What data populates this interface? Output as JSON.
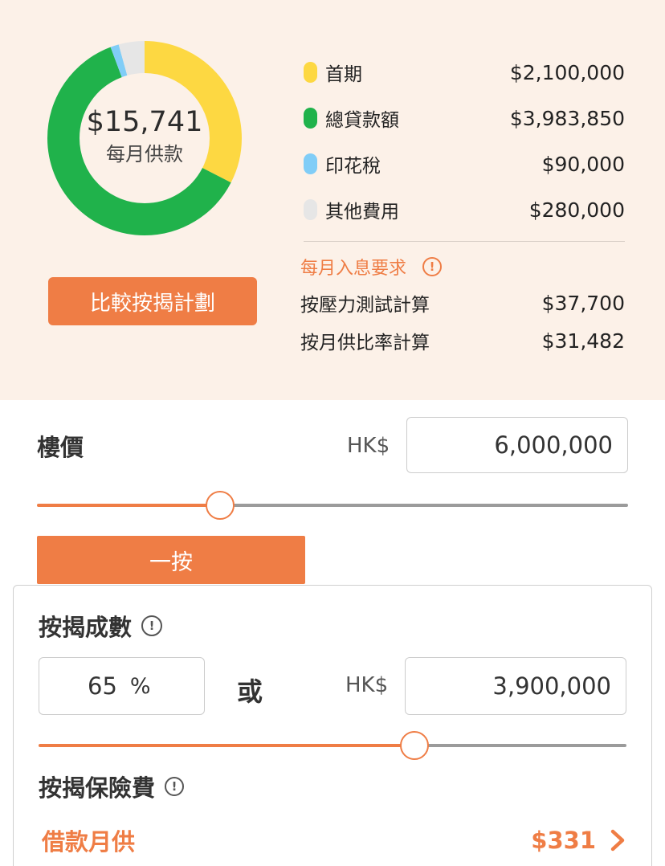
{
  "summary": {
    "monthly_amount": "$15,741",
    "monthly_label": "每月供款",
    "compare_button": "比較按揭計劃",
    "legend": [
      {
        "label": "首期",
        "value": "$2,100,000",
        "amount": 2100000,
        "color": "#fdd842"
      },
      {
        "label": "總貸款額",
        "value": "$3,983,850",
        "amount": 3983850,
        "color": "#20b24b"
      },
      {
        "label": "印花稅",
        "value": "$90,000",
        "amount": 90000,
        "color": "#80cdf7"
      },
      {
        "label": "其他費用",
        "value": "$280,000",
        "amount": 280000,
        "color": "#e6e6e6"
      }
    ],
    "interest_title": "每月入息要求",
    "interest_rows": [
      {
        "label": "按壓力測試計算",
        "value": "$37,700"
      },
      {
        "label": "按月供比率計算",
        "value": "$31,482"
      }
    ]
  },
  "property": {
    "label": "樓價",
    "currency": "HK$",
    "value": "6,000,000",
    "slider_fraction": 0.31
  },
  "tabs": {
    "first": "一按"
  },
  "mortgage": {
    "title": "按揭成數",
    "percent_value": "65",
    "percent_unit": "%",
    "or_label": "或",
    "currency": "HK$",
    "amount_value": "3,900,000",
    "slider_fraction": 0.64,
    "insurance_title": "按揭保險費",
    "monthly_label": "借款月供",
    "monthly_value": "$331"
  },
  "colors": {
    "accent": "#ef7d45",
    "summary_bg": "#fcf1e8"
  }
}
